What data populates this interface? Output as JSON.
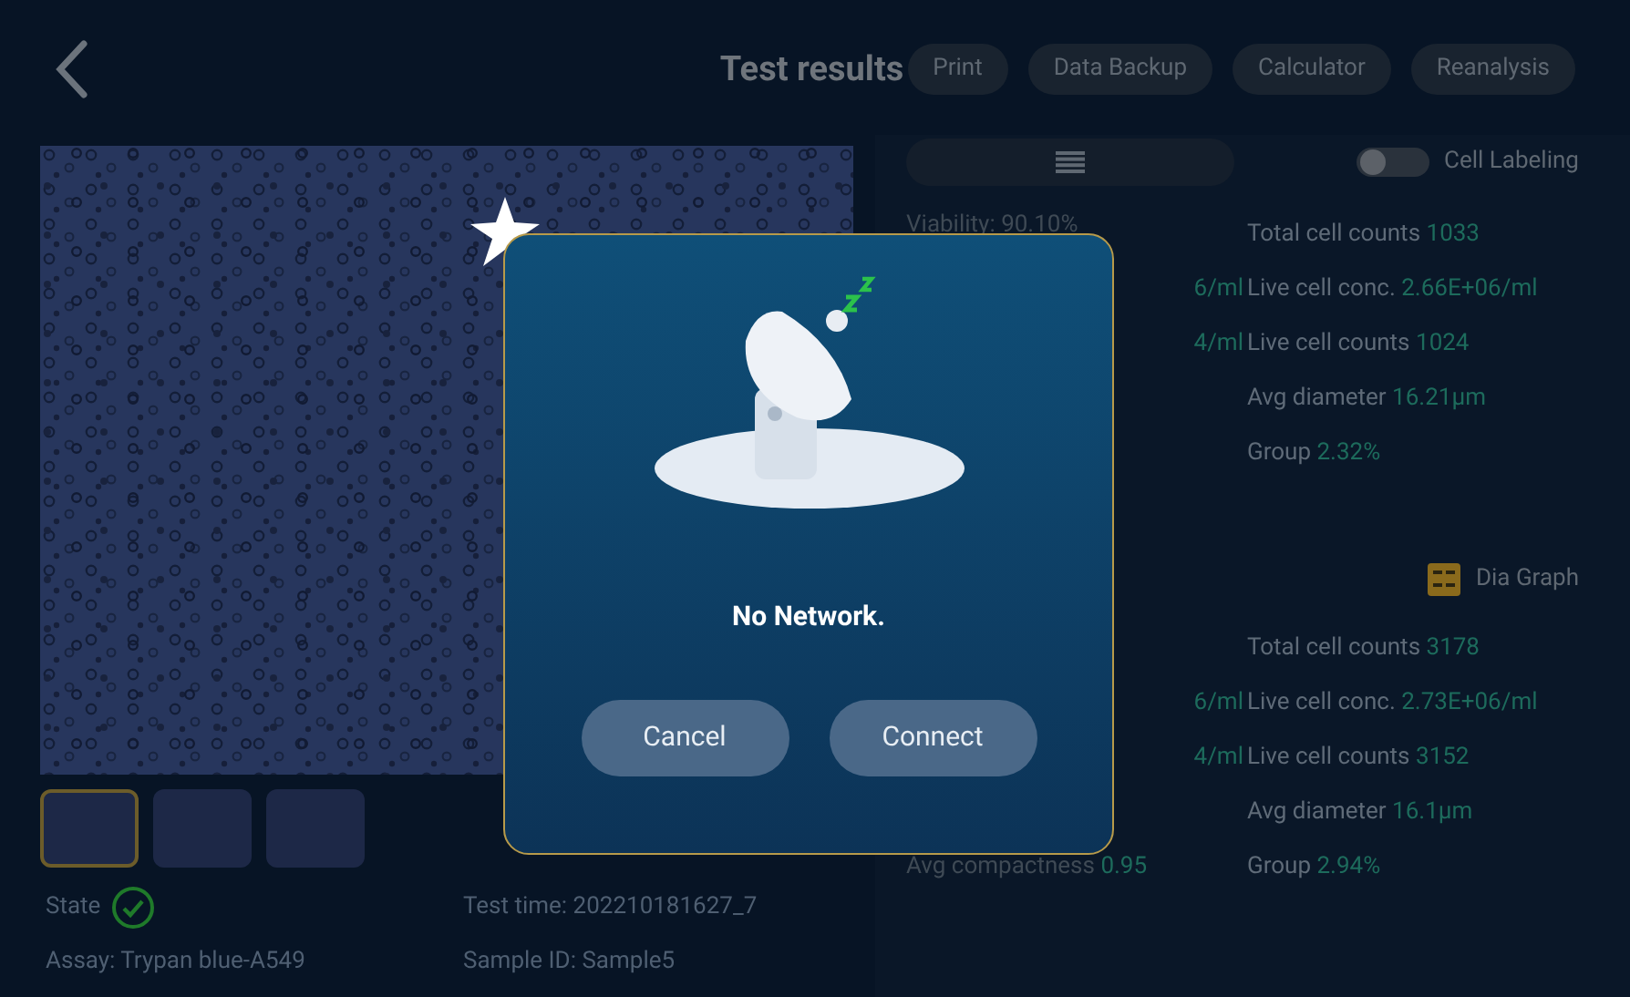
{
  "header": {
    "title": "Test results",
    "buttons": [
      "Print",
      "Data Backup",
      "Calculator",
      "Reanalysis"
    ]
  },
  "thumbnails": [
    {
      "selected": true
    },
    {
      "selected": false
    },
    {
      "selected": false
    }
  ],
  "info": {
    "state_label": "State",
    "state_ok": true,
    "test_time": "Test time: 202210181627_7",
    "assay": "Assay: Trypan blue-A549",
    "sample_id": "Sample ID: Sample5"
  },
  "cell_labeling": {
    "label": "Cell Labeling",
    "on": false
  },
  "group1": {
    "left": [
      "Viability: 90.10%",
      "6/ml",
      "4/ml"
    ],
    "right": [
      {
        "label": "Total cell counts",
        "value": "1033"
      },
      {
        "label": "Live cell conc.",
        "value": "2.66E+06/ml"
      },
      {
        "label": "Live cell counts",
        "value": "1024"
      },
      {
        "label": "Avg diameter",
        "value": "16.21µm"
      },
      {
        "label": "Group",
        "value": "2.32%"
      }
    ]
  },
  "dia_graph": "Dia Graph",
  "group2": {
    "left": [
      "6/ml",
      "4/ml"
    ],
    "compactness": {
      "label": "Avg compactness",
      "value": "0.95"
    },
    "right": [
      {
        "label": "Total cell counts",
        "value": "3178"
      },
      {
        "label": "Live cell conc.",
        "value": "2.73E+06/ml"
      },
      {
        "label": "Live cell counts",
        "value": "3152"
      },
      {
        "label": "Avg diameter",
        "value": "16.1µm"
      },
      {
        "label": "Group",
        "value": "2.94%"
      }
    ]
  },
  "dialog": {
    "message": "No Network.",
    "buttons": [
      "Cancel",
      "Connect"
    ]
  }
}
